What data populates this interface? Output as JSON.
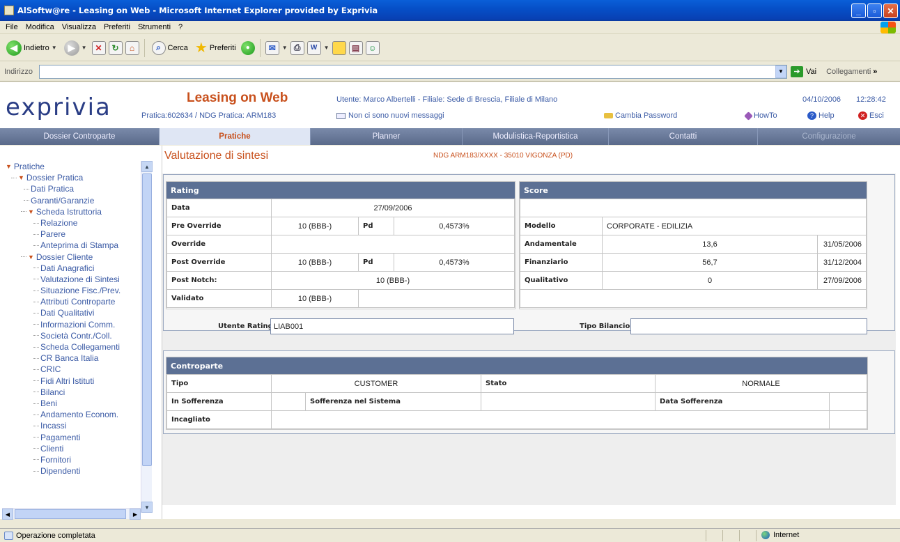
{
  "window": {
    "title": "AlSoftw@re - Leasing on Web - Microsoft Internet Explorer provided by Exprivia"
  },
  "menu": [
    "File",
    "Modifica",
    "Visualizza",
    "Preferiti",
    "Strumenti",
    "?"
  ],
  "toolbar": {
    "back_label": "Indietro",
    "search_label": "Cerca",
    "favorites_label": "Preferiti"
  },
  "address": {
    "label": "Indirizzo",
    "value": "",
    "go_label": "Vai",
    "links_label": "Collegamenti"
  },
  "header": {
    "logo_text": "exprivia",
    "app_title": "Leasing on Web",
    "pratica_info": "Pratica:602634 / NDG Pratica: ARM183",
    "user_info": "Utente: Marco Albertelli - Filiale: Sede di Brescia, Filiale di Milano",
    "messages": "Non ci sono nuovi messaggi",
    "date": "04/10/2006",
    "time": "12:28:42",
    "change_password": "Cambia Password",
    "howto": "HowTo",
    "help": "Help",
    "exit": "Esci"
  },
  "nav": {
    "tabs": [
      {
        "label": "Dossier Controparte",
        "state": "normal"
      },
      {
        "label": "Pratiche",
        "state": "active"
      },
      {
        "label": "Planner",
        "state": "normal"
      },
      {
        "label": "Modulistica-Reportistica",
        "state": "normal"
      },
      {
        "label": "Contatti",
        "state": "normal"
      },
      {
        "label": "Configurazione",
        "state": "disabled"
      }
    ]
  },
  "sidebar": {
    "items": [
      {
        "label": "Pratiche",
        "level": 0,
        "expanded": true
      },
      {
        "label": "Dossier Pratica",
        "level": 1,
        "expanded": true
      },
      {
        "label": "Dati Pratica",
        "level": 2
      },
      {
        "label": "Garanti/Garanzie",
        "level": 2
      },
      {
        "label": "Scheda Istruttoria",
        "level": 2,
        "expanded": true
      },
      {
        "label": "Relazione",
        "level": 3
      },
      {
        "label": "Parere",
        "level": 3
      },
      {
        "label": "Anteprima di Stampa",
        "level": 3
      },
      {
        "label": "Dossier Cliente",
        "level": 2,
        "expanded": true
      },
      {
        "label": "Dati Anagrafici",
        "level": 3
      },
      {
        "label": "Valutazione di Sintesi",
        "level": 3
      },
      {
        "label": "Situazione Fisc./Prev.",
        "level": 3
      },
      {
        "label": "Attributi Controparte",
        "level": 3
      },
      {
        "label": "Dati Qualitativi",
        "level": 3
      },
      {
        "label": "Informazioni Comm.",
        "level": 3
      },
      {
        "label": "Società Contr./Coll.",
        "level": 3
      },
      {
        "label": "Scheda Collegamenti",
        "level": 3
      },
      {
        "label": "CR Banca Italia",
        "level": 3
      },
      {
        "label": "CRIC",
        "level": 3
      },
      {
        "label": "Fidi Altri Istituti",
        "level": 3
      },
      {
        "label": "Bilanci",
        "level": 3
      },
      {
        "label": "Beni",
        "level": 3
      },
      {
        "label": "Andamento Econom.",
        "level": 3
      },
      {
        "label": "Incassi",
        "level": 3
      },
      {
        "label": "Pagamenti",
        "level": 3
      },
      {
        "label": "Clienti",
        "level": 3
      },
      {
        "label": "Fornitori",
        "level": 3
      },
      {
        "label": "Dipendenti",
        "level": 3
      }
    ]
  },
  "main": {
    "title": "Valutazione di sintesi",
    "ndg": "NDG ARM183/XXXX - 35010 VIGONZA (PD)",
    "rating": {
      "header": "Rating",
      "data_label": "Data",
      "data_value": "27/09/2006",
      "pre_override_label": "Pre Override",
      "pre_override_value": "10 (BBB-)",
      "pd_label": "Pd",
      "pre_pd_value": "0,4573%",
      "override_label": "Override",
      "override_value": "",
      "post_override_label": "Post Override",
      "post_override_value": "10 (BBB-)",
      "post_pd_value": "0,4573%",
      "post_notch_label": "Post Notch:",
      "post_notch_value": "10 (BBB-)",
      "validato_label": "Validato",
      "validato_value": "10 (BBB-)",
      "utente_rating_label": "Utente Rating:",
      "utente_rating_value": "LIAB001"
    },
    "score": {
      "header": "Score",
      "modello_label": "Modello",
      "modello_value": "CORPORATE - EDILIZIA",
      "rows": [
        {
          "label": "Andamentale",
          "value": "13,6",
          "date": "31/05/2006"
        },
        {
          "label": "Finanziario",
          "value": "56,7",
          "date": "31/12/2004"
        },
        {
          "label": "Qualitativo",
          "value": "0",
          "date": "27/09/2006"
        }
      ],
      "tipo_bilancio_label": "Tipo Bilancio:",
      "tipo_bilancio_value": ""
    },
    "controparte": {
      "header": "Controparte",
      "tipo_label": "Tipo",
      "tipo_value": "CUSTOMER",
      "stato_label": "Stato",
      "stato_value": "NORMALE",
      "in_sofferenza_label": "In Sofferenza",
      "sofferenza_sistema_label": "Sofferenza nel Sistema",
      "data_sofferenza_label": "Data Sofferenza",
      "incagliato_label": "Incagliato"
    }
  },
  "status": {
    "text": "Operazione completata",
    "zone": "Internet"
  }
}
